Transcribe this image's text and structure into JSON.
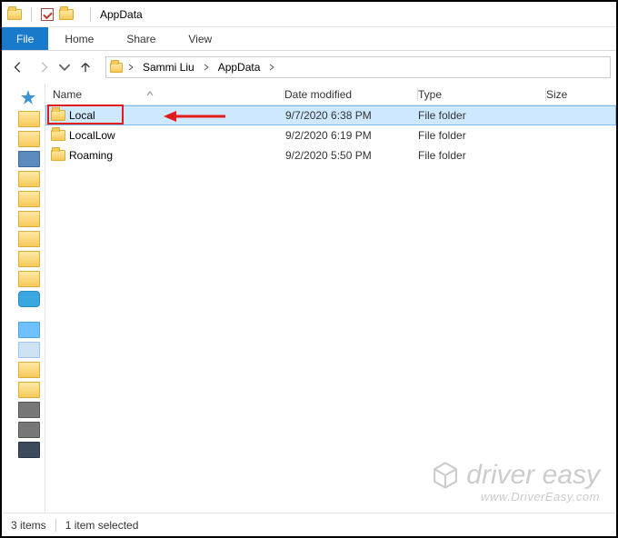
{
  "window": {
    "title": "AppData"
  },
  "ribbon": {
    "file": "File",
    "tabs": [
      "Home",
      "Share",
      "View"
    ]
  },
  "breadcrumb": {
    "segments": [
      "Sammi Liu",
      "AppData"
    ]
  },
  "columns": {
    "name": "Name",
    "date": "Date modified",
    "type": "Type",
    "size": "Size"
  },
  "rows": [
    {
      "name": "Local",
      "date": "9/7/2020 6:38 PM",
      "type": "File folder",
      "selected": true
    },
    {
      "name": "LocalLow",
      "date": "9/2/2020 6:19 PM",
      "type": "File folder",
      "selected": false
    },
    {
      "name": "Roaming",
      "date": "9/2/2020 5:50 PM",
      "type": "File folder",
      "selected": false
    }
  ],
  "status": {
    "count": "3 items",
    "selection": "1 item selected"
  },
  "watermark": {
    "brand": "driver easy",
    "url": "www.DriverEasy.com"
  }
}
